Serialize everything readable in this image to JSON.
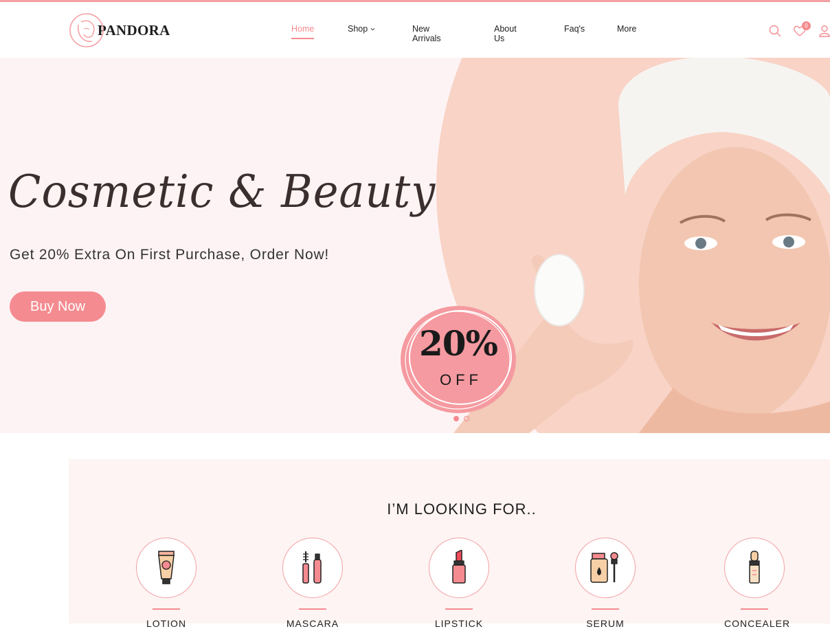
{
  "brand": {
    "name": "PANDORA"
  },
  "nav": [
    {
      "label": "Home",
      "active": true
    },
    {
      "label": "Shop",
      "has_dropdown": true
    },
    {
      "label": "New Arrivals"
    },
    {
      "label": "About Us"
    },
    {
      "label": "Faq's"
    },
    {
      "label": "More"
    }
  ],
  "header_icons": {
    "search": "search-icon",
    "wishlist": "heart-icon",
    "wishlist_count": "0",
    "account": "user-icon"
  },
  "hero": {
    "title": "Cosmetic & Beauty",
    "subtitle": "Get 20% Extra On First Purchase, Order Now!",
    "cta": "Buy Now",
    "badge_percent": "20%",
    "badge_off": "OFF",
    "slides": 2,
    "active_slide": 1
  },
  "categories": {
    "title": "I’M LOOKING FOR..",
    "items": [
      {
        "label": "LOTION",
        "icon": "lotion-icon"
      },
      {
        "label": "MASCARA",
        "icon": "mascara-icon"
      },
      {
        "label": "LIPSTICK",
        "icon": "lipstick-icon"
      },
      {
        "label": "SERUM",
        "icon": "serum-icon"
      },
      {
        "label": "CONCEALER",
        "icon": "concealer-icon"
      }
    ]
  },
  "colors": {
    "accent": "#f48b90",
    "hero_bg": "#fdf3f4",
    "section_bg": "#fdf4f3"
  }
}
